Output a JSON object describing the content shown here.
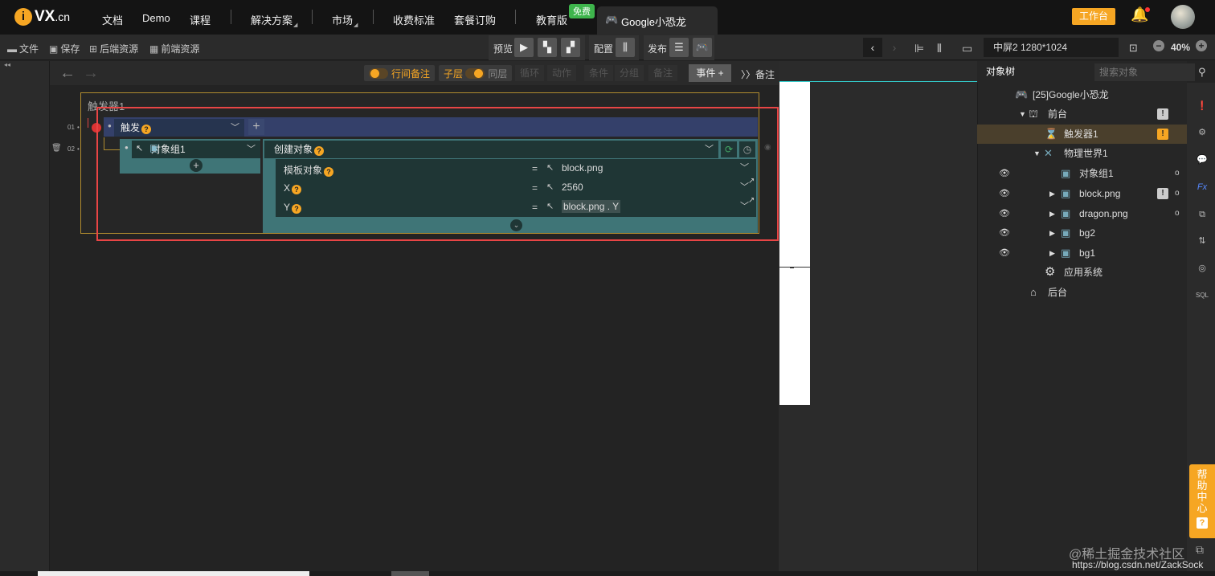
{
  "logo": {
    "i": "i",
    "text": "VX",
    "suffix": ".cn"
  },
  "nav": [
    {
      "label": "文档"
    },
    {
      "label": "Demo"
    },
    {
      "label": "课程"
    },
    {
      "label": "解决方案",
      "has_caret": true
    },
    {
      "label": "市场",
      "has_caret": true
    },
    {
      "label": "收费标准"
    },
    {
      "label": "套餐订购"
    },
    {
      "label": "教育版"
    }
  ],
  "free_badge": "免费",
  "active_tab": "Google小恐龙",
  "workbench_button": "工作台",
  "toolbar": {
    "file": "文件",
    "save": "保存",
    "backend_res": "后端资源",
    "frontend_res": "前端资源",
    "preview": "预览",
    "config": "配置",
    "publish": "发布",
    "screen": "中屏2 1280*1024",
    "zoom": "40%"
  },
  "subbar": {
    "inline_note": "行间备注",
    "child_layer": "子层",
    "same_layer": "同层",
    "loop": "循环",
    "action": "动作",
    "condition": "条件",
    "branch": "分组",
    "note": "备注",
    "event_button": "事件 +",
    "note_btn": "备注"
  },
  "trigger": {
    "title": "触发器1",
    "row1_num": "01",
    "row2_num": "02",
    "trigger_label": "触发",
    "target": "对象组1",
    "action": "创建对象",
    "params": [
      {
        "label": "模板对象",
        "help": true,
        "value": "block.png"
      },
      {
        "label": "X",
        "help": true,
        "value": "2560"
      },
      {
        "label": "Y",
        "help": true,
        "value": "block.png . Y"
      }
    ]
  },
  "object_tree": {
    "tab": "对象树",
    "search_placeholder": "搜索对象",
    "rows": [
      {
        "label": "[25]Google小恐龙"
      },
      {
        "label": "前台"
      },
      {
        "label": "触发器1"
      },
      {
        "label": "物理世界1"
      },
      {
        "label": "对象组1"
      },
      {
        "label": "block.png"
      },
      {
        "label": "dragon.png"
      },
      {
        "label": "bg2"
      },
      {
        "label": "bg1"
      },
      {
        "label": "应用系统"
      },
      {
        "label": "后台"
      }
    ]
  },
  "help_center": "帮助中心",
  "watermark": "@稀土掘金技术社区",
  "watermark_url": "https://blog.csdn.net/ZackSock",
  "colors": {
    "accent": "#f6a623",
    "highlight_box": "#e84545",
    "action_teal": "#3f7577",
    "trigger_blue": "#34406a"
  }
}
